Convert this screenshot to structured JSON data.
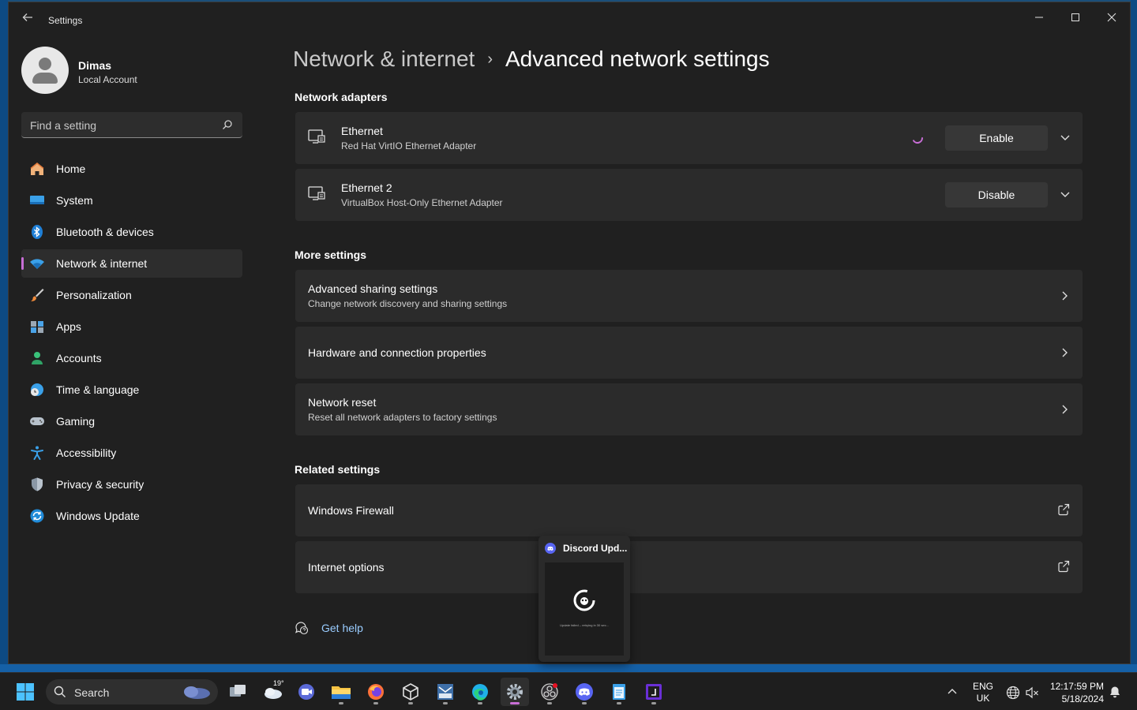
{
  "window": {
    "title": "Settings",
    "controls": {
      "minimize": "—",
      "maximize": "☐",
      "close": "✕"
    }
  },
  "profile": {
    "name": "Dimas",
    "account": "Local Account"
  },
  "search": {
    "placeholder": "Find a setting"
  },
  "nav": {
    "items": [
      {
        "label": "Home",
        "icon": "home-icon",
        "active": false
      },
      {
        "label": "System",
        "icon": "system-icon",
        "active": false
      },
      {
        "label": "Bluetooth & devices",
        "icon": "bluetooth-icon",
        "active": false
      },
      {
        "label": "Network & internet",
        "icon": "wifi-icon",
        "active": true
      },
      {
        "label": "Personalization",
        "icon": "brush-icon",
        "active": false
      },
      {
        "label": "Apps",
        "icon": "apps-icon",
        "active": false
      },
      {
        "label": "Accounts",
        "icon": "accounts-icon",
        "active": false
      },
      {
        "label": "Time & language",
        "icon": "globe-clock-icon",
        "active": false
      },
      {
        "label": "Gaming",
        "icon": "gamepad-icon",
        "active": false
      },
      {
        "label": "Accessibility",
        "icon": "accessibility-icon",
        "active": false
      },
      {
        "label": "Privacy & security",
        "icon": "shield-icon",
        "active": false
      },
      {
        "label": "Windows Update",
        "icon": "update-icon",
        "active": false
      }
    ]
  },
  "breadcrumb": {
    "parent": "Network & internet",
    "separator": "›",
    "current": "Advanced network settings"
  },
  "sections": {
    "adapters_title": "Network adapters",
    "more_title": "More settings",
    "related_title": "Related settings"
  },
  "adapters": [
    {
      "name": "Ethernet",
      "description": "Red Hat VirtIO Ethernet Adapter",
      "button": "Enable",
      "loading": true
    },
    {
      "name": "Ethernet 2",
      "description": "VirtualBox Host-Only Ethernet Adapter",
      "button": "Disable",
      "loading": false
    }
  ],
  "more_settings": [
    {
      "title": "Advanced sharing settings",
      "subtitle": "Change network discovery and sharing settings"
    },
    {
      "title": "Hardware and connection properties",
      "subtitle": ""
    },
    {
      "title": "Network reset",
      "subtitle": "Reset all network adapters to factory settings"
    }
  ],
  "related_settings": [
    {
      "title": "Windows Firewall"
    },
    {
      "title": "Internet options"
    }
  ],
  "help": {
    "label": "Get help"
  },
  "discord_popup": {
    "title": "Discord Upd...",
    "preview_text": "Update failed – retrying in 30 sec..."
  },
  "taskbar": {
    "search_label": "Search",
    "weather_temp": "19°",
    "language": {
      "line1": "ENG",
      "line2": "UK"
    },
    "clock": {
      "time": "12:17:59 PM",
      "date": "5/18/2024"
    }
  },
  "colors": {
    "accent": "#c86ed6",
    "link": "#99ccff",
    "window_bg": "#202020",
    "card_bg": "#2b2b2b"
  }
}
